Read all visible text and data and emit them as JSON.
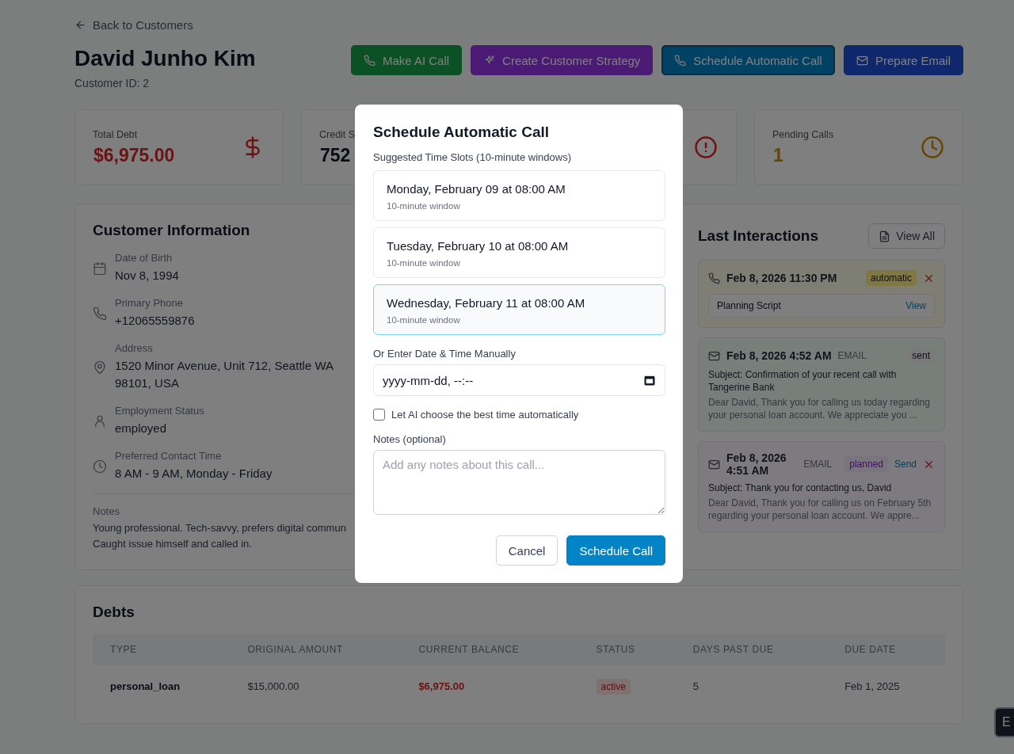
{
  "back_link": "Back to Customers",
  "customer": {
    "name": "David Junho Kim",
    "id_text": "Customer ID: 2"
  },
  "actions": [
    {
      "kind": "call",
      "label": "Make AI Call",
      "color": "#0b5125",
      "focused": false
    },
    {
      "kind": "sparkle",
      "label": "Create Customer Strategy",
      "color": "#4a1a75",
      "focused": false
    },
    {
      "kind": "call",
      "label": "Schedule Automatic Call",
      "color": "#014264",
      "focused": true
    },
    {
      "kind": "mail",
      "label": "Prepare Email",
      "color": "#0f276c",
      "focused": false
    }
  ],
  "stats": [
    {
      "kind": "dollar",
      "label": "Total Debt",
      "value": "$6,975.00"
    },
    {
      "kind": "plain",
      "label": "Credit S",
      "value": "752"
    },
    {
      "kind": "alert"
    },
    {
      "kind": "clock",
      "label": "Pending Calls",
      "value": "1"
    }
  ],
  "customer_info": {
    "title": "Customer Information",
    "fields": [
      {
        "kind": "calendar",
        "label": "Date of Birth",
        "value": "Nov 8, 1994"
      },
      {
        "kind": "phone",
        "label": "Primary Phone",
        "value": "+12065559876"
      },
      {
        "kind": "pin",
        "label": "Address",
        "value": "1520 Minor Avenue, Unit 712, Seattle WA 98101, USA"
      },
      {
        "kind": "person",
        "label": "Employment Status",
        "value": "employed"
      },
      {
        "kind": "clock",
        "label": "Preferred Contact Time",
        "value": "8 AM - 9 AM, Monday - Friday"
      }
    ],
    "notes_label": "Notes",
    "notes": "Young professional. Tech-savvy, prefers digital commun Caught issue himself and called in."
  },
  "interactions": {
    "title": "Last Interactions",
    "view_all": "View All",
    "items": [
      {
        "kind": "call",
        "color": "#7f7e74",
        "date": "Feb 8, 2026 11:30 PM",
        "badge": {
          "text": "automatic",
          "color": "#7f7845"
        },
        "deletable": true,
        "script_label": "Planning Script",
        "script_link": "View"
      },
      {
        "kind": "email",
        "color": "#787f7a",
        "date": "Feb 8, 2026 4:52 AM",
        "channel": "EMAIL",
        "badge": {
          "text": "sent",
          "color": "#7a7a7b"
        },
        "deletable": false,
        "subject": "Subject: Confirmation of your recent call with Tangerine Bank",
        "preview": "Dear David, Thank you for calling us today regarding your personal loan account. We appreciate you ..."
      },
      {
        "kind": "email",
        "color": "#7d7b80",
        "date": "Feb 8, 2026 4:51 AM",
        "channel": "EMAIL",
        "badge": {
          "text": "planned",
          "color": "#7a7480"
        },
        "send": "Send",
        "deletable": true,
        "subject": "Subject: Thank you for contacting us, David",
        "preview": "Dear David, Thank you for calling us on February 5th regarding your personal loan account. We appre..."
      }
    ]
  },
  "debts": {
    "title": "Debts",
    "columns": [
      "TYPE",
      "ORIGINAL AMOUNT",
      "CURRENT BALANCE",
      "STATUS",
      "DAYS PAST DUE",
      "DUE DATE"
    ],
    "rows": [
      {
        "type": "personal_loan",
        "original_amount": "$15,000.00",
        "current_balance": "$6,975.00",
        "status": "active",
        "days_past_due": "5",
        "due_date": "Feb 1, 2025"
      }
    ]
  },
  "corner_button": "E",
  "modal": {
    "title": "Schedule Automatic Call",
    "slots_label": "Suggested Time Slots (10-minute windows)",
    "slots": [
      {
        "time": "Monday, February 09 at 08:00 AM",
        "note": "10-minute window",
        "selected": false
      },
      {
        "time": "Tuesday, February 10 at 08:00 AM",
        "note": "10-minute window",
        "selected": false
      },
      {
        "time": "Wednesday, February 11 at 08:00 AM",
        "note": "10-minute window",
        "selected": true
      }
    ],
    "manual_label": "Or Enter Date & Time Manually",
    "manual_value": "yyyy-mm-dd, --:--",
    "ai_choose": {
      "label": "Let AI choose the best time automatically",
      "checked": false
    },
    "notes_label": "Notes (optional)",
    "notes_placeholder": "Add any notes about this call...",
    "buttons": [
      {
        "kind": "secondary",
        "label": "Cancel"
      },
      {
        "kind": "primary",
        "label": "Schedule Call"
      }
    ]
  }
}
